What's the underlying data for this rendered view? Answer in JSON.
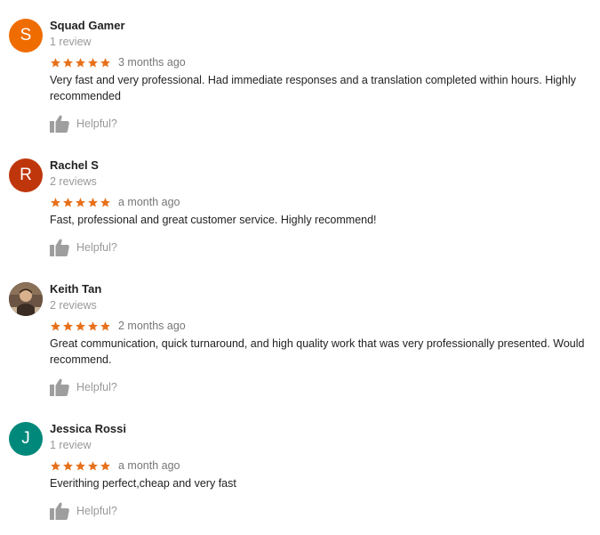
{
  "reviews": [
    {
      "name": "Squad Gamer",
      "review_count": "1 review",
      "avatar_letter": "S",
      "avatar_color": "#ef6c00",
      "rating": 5,
      "time_ago": "3 months ago",
      "text": "Very fast and very professional. Had immediate responses and a translation completed within hours. Highly recommended",
      "helpful_label": "Helpful?"
    },
    {
      "name": "Rachel S",
      "review_count": "2 reviews",
      "avatar_letter": "R",
      "avatar_color": "#bf360c",
      "rating": 5,
      "time_ago": "a month ago",
      "text": "Fast, professional and great customer service. Highly recommend!",
      "helpful_label": "Helpful?"
    },
    {
      "name": "Keith Tan",
      "review_count": "2 reviews",
      "avatar_letter": "",
      "avatar_color": "#5b4638",
      "rating": 5,
      "time_ago": "2 months ago",
      "text": "Great communication, quick turnaround, and high quality work that was very professionally presented. Would recommend.",
      "helpful_label": "Helpful?"
    },
    {
      "name": "Jessica Rossi",
      "review_count": "1 review",
      "avatar_letter": "J",
      "avatar_color": "#00897b",
      "rating": 5,
      "time_ago": "a month ago",
      "text": "Everithing perfect,cheap and very fast",
      "helpful_label": "Helpful?"
    }
  ],
  "star_color": "#e7711b",
  "helpful_icon": "thumbs-up-icon"
}
